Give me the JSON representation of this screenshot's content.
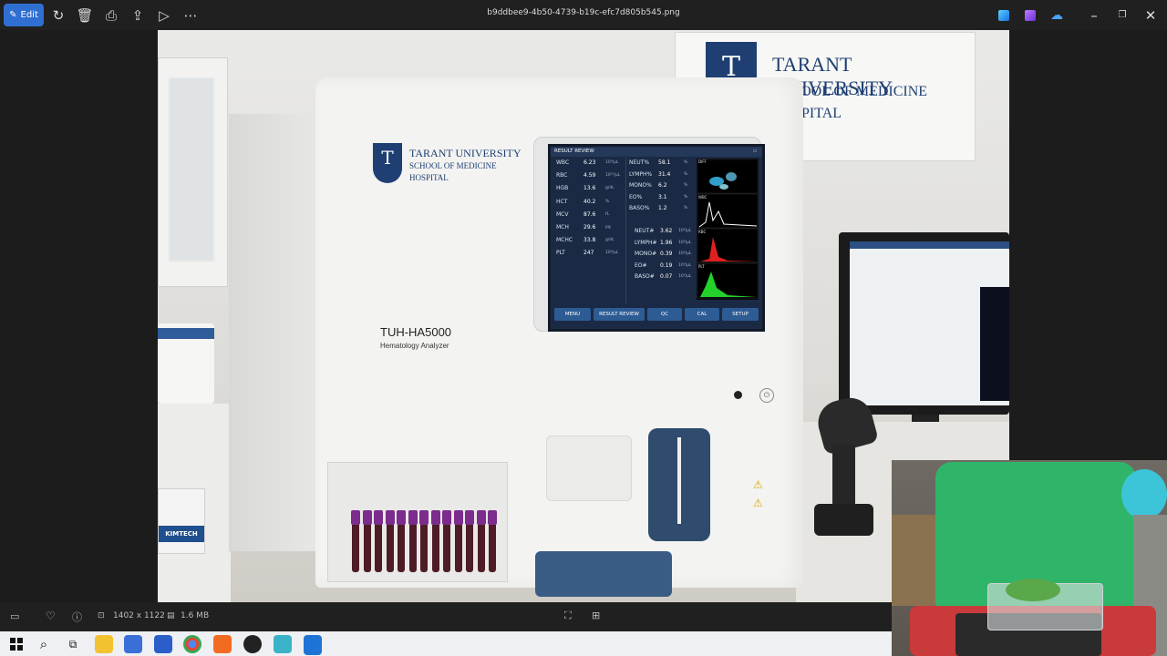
{
  "app": {
    "edit_label": "Edit",
    "filename": "b9ddbee9-4b50-4739-b19c-efc7d805b545.png"
  },
  "status": {
    "dimensions": "1402 x 1122",
    "filesize": "1.6 MB"
  },
  "photo": {
    "wall_sign": {
      "line1": "TARANT UNIVERSITY",
      "line2": "SCHOOL OF MEDICINE",
      "line3": "HOSPITAL"
    },
    "device_brand": {
      "line1": "TARANT UNIVERSITY",
      "line2": "SCHOOL OF MEDICINE",
      "line3": "HOSPITAL"
    },
    "model": "TUH-HA5000",
    "model_sub": "Hematology Analyzer",
    "box_label": "KIMTECH",
    "screen": {
      "title": "RESULT REVIEW",
      "left_rows": [
        {
          "label": "WBC",
          "value": "6.23",
          "unit": "10⁹/µL"
        },
        {
          "label": "RBC",
          "value": "4.59",
          "unit": "10¹²/µL"
        },
        {
          "label": "HGB",
          "value": "13.6",
          "unit": "g/dL"
        },
        {
          "label": "HCT",
          "value": "40.2",
          "unit": "%"
        },
        {
          "label": "MCV",
          "value": "87.6",
          "unit": "fL"
        },
        {
          "label": "MCH",
          "value": "29.6",
          "unit": "pg"
        },
        {
          "label": "MCHC",
          "value": "33.8",
          "unit": "g/dL"
        },
        {
          "label": "PLT",
          "value": "247",
          "unit": "10⁹/µL"
        }
      ],
      "right_pct_rows": [
        {
          "label": "NEUT%",
          "value": "58.1",
          "unit": "%"
        },
        {
          "label": "LYMPH%",
          "value": "31.4",
          "unit": "%"
        },
        {
          "label": "MONO%",
          "value": "6.2",
          "unit": "%"
        },
        {
          "label": "EO%",
          "value": "3.1",
          "unit": "%"
        },
        {
          "label": "BASO%",
          "value": "1.2",
          "unit": "%"
        }
      ],
      "right_abs_rows": [
        {
          "label": "NEUT#",
          "value": "3.62",
          "unit": "10⁹/µL"
        },
        {
          "label": "LYMPH#",
          "value": "1.96",
          "unit": "10⁹/µL"
        },
        {
          "label": "MONO#",
          "value": "0.39",
          "unit": "10⁹/µL"
        },
        {
          "label": "EO#",
          "value": "0.19",
          "unit": "10⁹/µL"
        },
        {
          "label": "BASO#",
          "value": "0.07",
          "unit": "10⁹/µL"
        }
      ],
      "plot_labels": [
        "DIFF",
        "WBC",
        "RBC",
        "PLT"
      ],
      "buttons": [
        "MENU",
        "RESULT REVIEW",
        "QC",
        "CAL",
        "SETUP"
      ]
    }
  }
}
